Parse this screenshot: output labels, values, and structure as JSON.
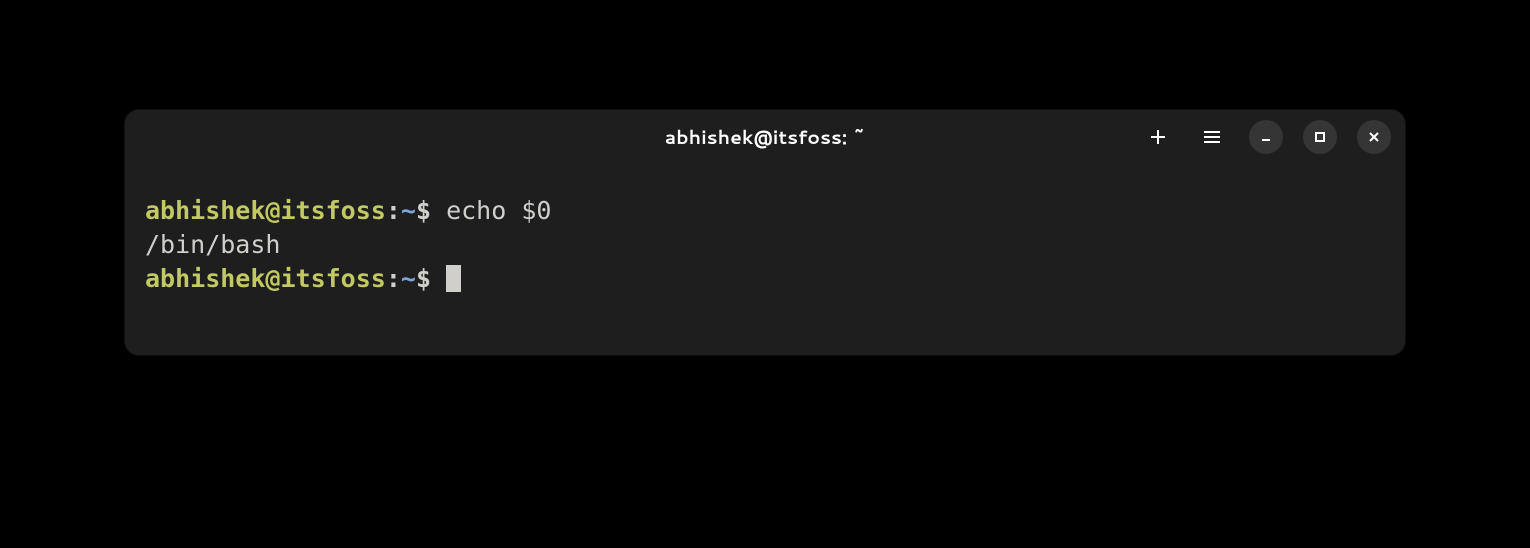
{
  "titlebar": {
    "title": "abhishek@itsfoss: ~"
  },
  "terminal": {
    "lines": [
      {
        "userhost": "abhishek@itsfoss",
        "colon": ":",
        "path": "~",
        "dollar": "$ ",
        "command": "echo $0"
      }
    ],
    "output": "/bin/bash",
    "prompt2": {
      "userhost": "abhishek@itsfoss",
      "colon": ":",
      "path": "~",
      "dollar": "$ "
    }
  }
}
